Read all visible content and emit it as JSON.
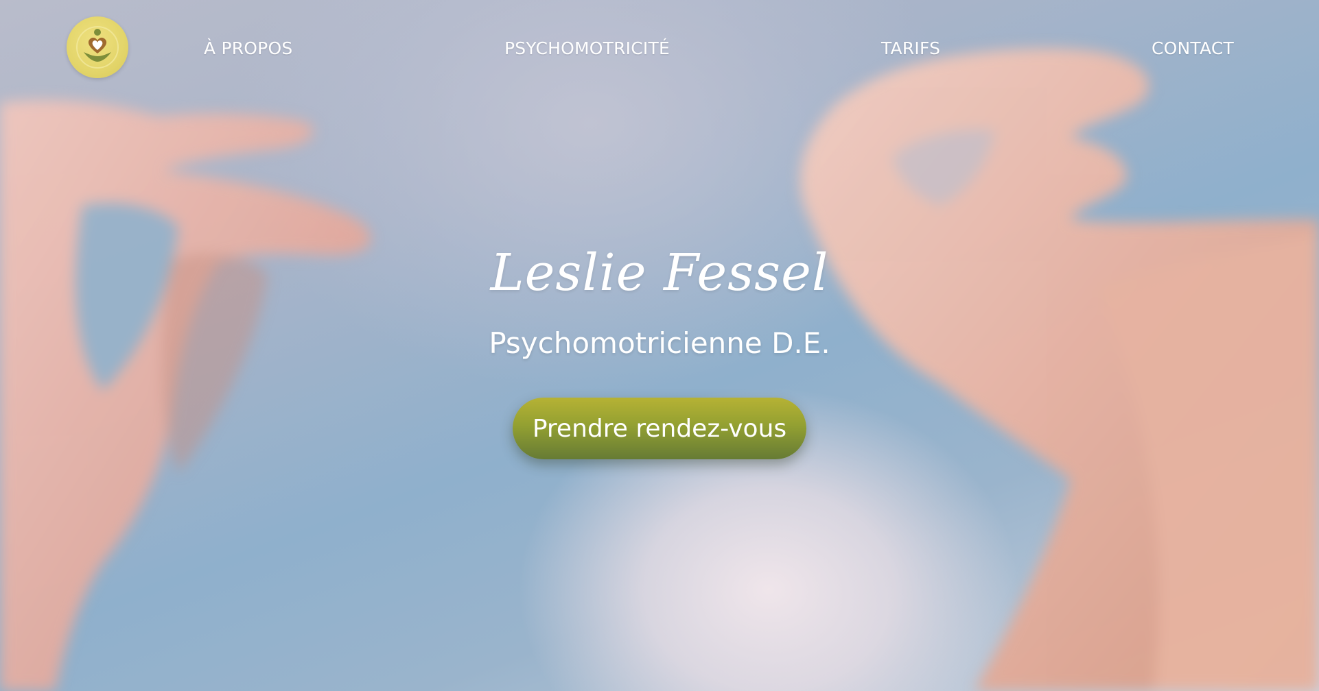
{
  "nav": {
    "logo_icon": "heart-lotus-logo-icon",
    "items": [
      {
        "label": "À PROPOS"
      },
      {
        "label": "PSYCHOMOTRICITÉ"
      },
      {
        "label": "TARIFS"
      },
      {
        "label": "CONTACT"
      }
    ]
  },
  "hero": {
    "name": "Leslie Fessel",
    "subtitle": "Psychomotricienne D.E.",
    "cta_label": "Prendre rendez-vous",
    "background_image": "hands-against-sky-photo"
  },
  "colors": {
    "logo_yellow": "#e3d56a",
    "logo_green": "#7d8e3a",
    "cta_top": "#b6b234",
    "cta_bottom": "#667b34",
    "text": "#ffffff"
  }
}
